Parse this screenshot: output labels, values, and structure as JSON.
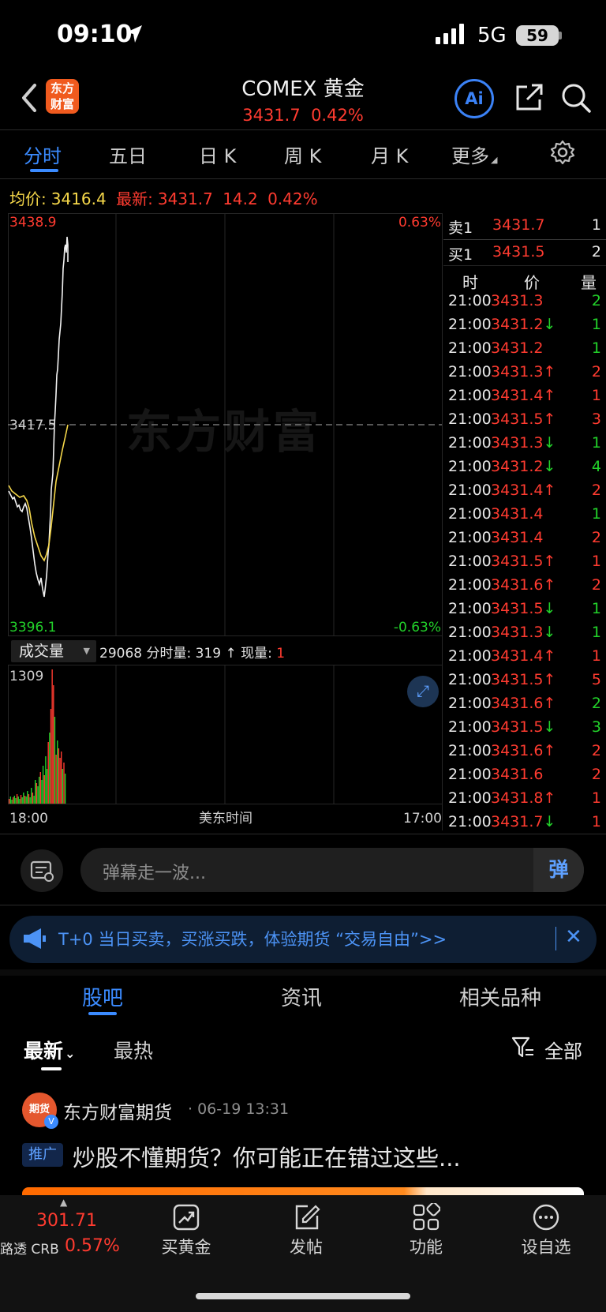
{
  "status_bar": {
    "time": "09:10",
    "network": "5G",
    "battery": "59"
  },
  "header": {
    "logo_line1": "东方",
    "logo_line2": "财富",
    "title": "COMEX 黄金",
    "price": "3431.7",
    "change_pct": "0.42%",
    "ai_label": "Ai"
  },
  "chart_tabs": [
    "分时",
    "五日",
    "日 K",
    "周 K",
    "月 K",
    "更多"
  ],
  "info": {
    "avg_label": "均价:",
    "avg_value": "3416.4",
    "latest_label": "最新:",
    "latest_value": "3431.7",
    "change": "14.2",
    "change_pct": "0.42%"
  },
  "chart": {
    "watermark": "东方财富",
    "top_price": "3438.9",
    "mid_price": "3417.5",
    "bottom_price": "3396.1",
    "top_pct": "0.63%",
    "bottom_pct": "-0.63%",
    "volume_max": "1309",
    "time_start": "18:00",
    "time_mid": "美东时间",
    "time_end": "17:00"
  },
  "volume": {
    "selector": "成交量",
    "total": "29068",
    "period_label": "分时量:",
    "period_value": "319",
    "period_arrow": "↑",
    "now_label": "现量:",
    "now_value": "1"
  },
  "order_book": {
    "ask": {
      "label": "卖1",
      "price": "3431.7",
      "qty": "1"
    },
    "bid": {
      "label": "买1",
      "price": "3431.5",
      "qty": "2"
    },
    "columns": [
      "时",
      "价",
      "量"
    ]
  },
  "trades": [
    {
      "t": "21:00",
      "p": "3431.3",
      "a": "",
      "v": "2",
      "vc": "g"
    },
    {
      "t": "21:00",
      "p": "3431.2",
      "a": "↓",
      "v": "1",
      "vc": "g"
    },
    {
      "t": "21:00",
      "p": "3431.2",
      "a": "",
      "v": "1",
      "vc": "g"
    },
    {
      "t": "21:00",
      "p": "3431.3",
      "a": "↑",
      "v": "2",
      "vc": "r"
    },
    {
      "t": "21:00",
      "p": "3431.4",
      "a": "↑",
      "v": "1",
      "vc": "r"
    },
    {
      "t": "21:00",
      "p": "3431.5",
      "a": "↑",
      "v": "3",
      "vc": "r"
    },
    {
      "t": "21:00",
      "p": "3431.3",
      "a": "↓",
      "v": "1",
      "vc": "g"
    },
    {
      "t": "21:00",
      "p": "3431.2",
      "a": "↓",
      "v": "4",
      "vc": "g"
    },
    {
      "t": "21:00",
      "p": "3431.4",
      "a": "↑",
      "v": "2",
      "vc": "r"
    },
    {
      "t": "21:00",
      "p": "3431.4",
      "a": "",
      "v": "1",
      "vc": "g"
    },
    {
      "t": "21:00",
      "p": "3431.4",
      "a": "",
      "v": "2",
      "vc": "r"
    },
    {
      "t": "21:00",
      "p": "3431.5",
      "a": "↑",
      "v": "1",
      "vc": "r"
    },
    {
      "t": "21:00",
      "p": "3431.6",
      "a": "↑",
      "v": "2",
      "vc": "r"
    },
    {
      "t": "21:00",
      "p": "3431.5",
      "a": "↓",
      "v": "1",
      "vc": "g"
    },
    {
      "t": "21:00",
      "p": "3431.3",
      "a": "↓",
      "v": "1",
      "vc": "g"
    },
    {
      "t": "21:00",
      "p": "3431.4",
      "a": "↑",
      "v": "1",
      "vc": "r"
    },
    {
      "t": "21:00",
      "p": "3431.5",
      "a": "↑",
      "v": "5",
      "vc": "r"
    },
    {
      "t": "21:00",
      "p": "3431.6",
      "a": "↑",
      "v": "2",
      "vc": "g"
    },
    {
      "t": "21:00",
      "p": "3431.5",
      "a": "↓",
      "v": "3",
      "vc": "g"
    },
    {
      "t": "21:00",
      "p": "3431.6",
      "a": "↑",
      "v": "2",
      "vc": "r"
    },
    {
      "t": "21:00",
      "p": "3431.6",
      "a": "",
      "v": "2",
      "vc": "r"
    },
    {
      "t": "21:00",
      "p": "3431.8",
      "a": "↑",
      "v": "1",
      "vc": "r"
    },
    {
      "t": "21:00",
      "p": "3431.7",
      "a": "↓",
      "v": "1",
      "vc": "r"
    }
  ],
  "danmaku": {
    "placeholder": "弹幕走一波...",
    "send_label": "弹"
  },
  "promo": {
    "text": "T+0 当日买卖，买涨买跌，体验期货 “交易自由”>>"
  },
  "section_tabs": [
    "股吧",
    "资讯",
    "相关品种"
  ],
  "sort_tabs": {
    "latest": "最新",
    "hot": "最热",
    "filter": "全部"
  },
  "post": {
    "avatar_text": "期货",
    "author": "东方财富期货",
    "time": "· 06-19 13:31",
    "badge": "推广",
    "title": "炒股不懂期货？你可能正在错过这些..."
  },
  "bottom_bar": {
    "index_value": "301.71",
    "index_name": "路透 CRB",
    "index_pct": "0.57%",
    "items": [
      "买黄金",
      "发帖",
      "功能",
      "设自选"
    ]
  },
  "colors": {
    "up": "#ff3b30",
    "down": "#22d12a",
    "accent": "#3b8bff",
    "avg_line": "#f6d84a"
  }
}
